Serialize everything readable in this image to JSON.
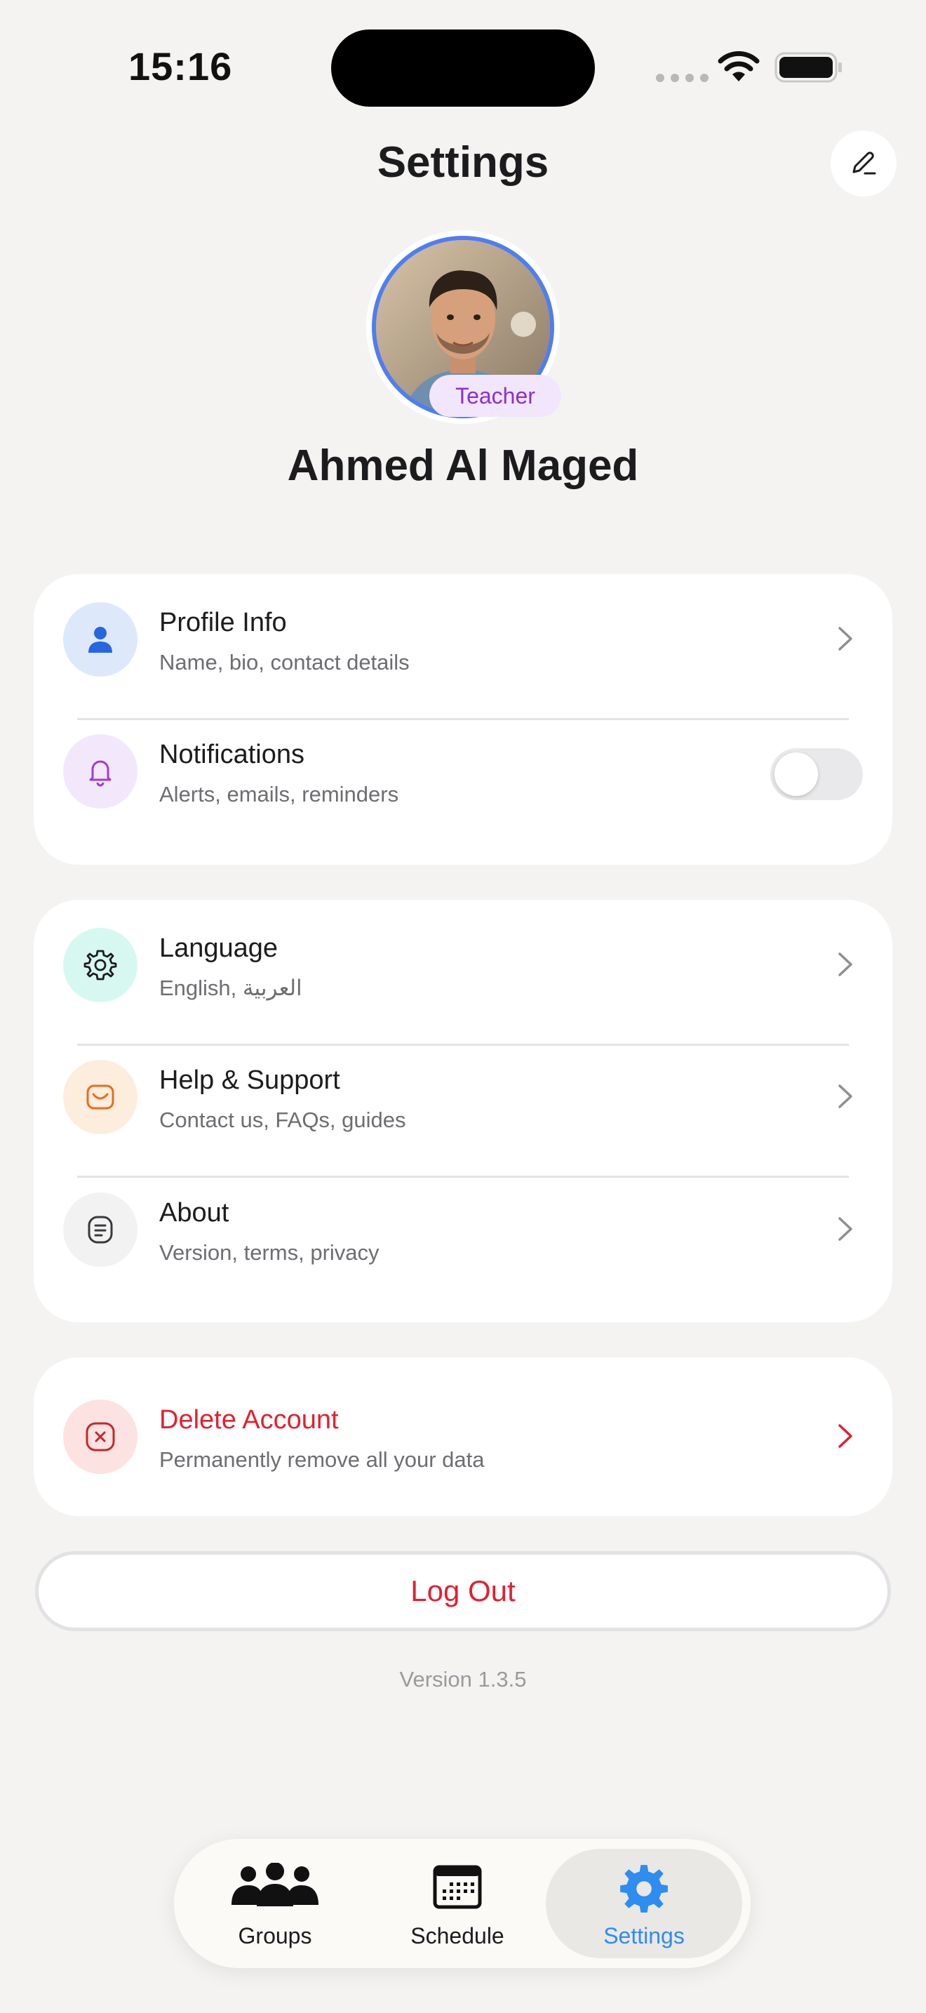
{
  "status_bar": {
    "time": "15:16"
  },
  "header": {
    "title": "Settings"
  },
  "profile": {
    "name": "Ahmed Al Maged",
    "role": "Teacher"
  },
  "sections": {
    "profile_info": {
      "title": "Profile Info",
      "subtitle": "Name, bio, contact details"
    },
    "notifications": {
      "title": "Notifications",
      "subtitle": "Alerts, emails, reminders",
      "enabled": false
    },
    "language": {
      "title": "Language",
      "subtitle": "English, العربية"
    },
    "help": {
      "title": "Help & Support",
      "subtitle": "Contact us, FAQs, guides"
    },
    "about": {
      "title": "About",
      "subtitle": "Version, terms, privacy"
    },
    "delete": {
      "title": "Delete Account",
      "subtitle": "Permanently remove all your data"
    }
  },
  "logout_label": "Log Out",
  "version": "Version 1.3.5",
  "tabs": [
    {
      "label": "Groups",
      "icon": "groups-icon",
      "active": false
    },
    {
      "label": "Schedule",
      "icon": "calendar-icon",
      "active": false
    },
    {
      "label": "Settings",
      "icon": "gear-icon",
      "active": true
    }
  ],
  "colors": {
    "accent": "#2f8cf0",
    "danger": "#e3202f",
    "role_badge_bg": "#f1e6fb",
    "role_badge_text": "#8e2fd0",
    "avatar_ring": "#4f7ef0"
  }
}
